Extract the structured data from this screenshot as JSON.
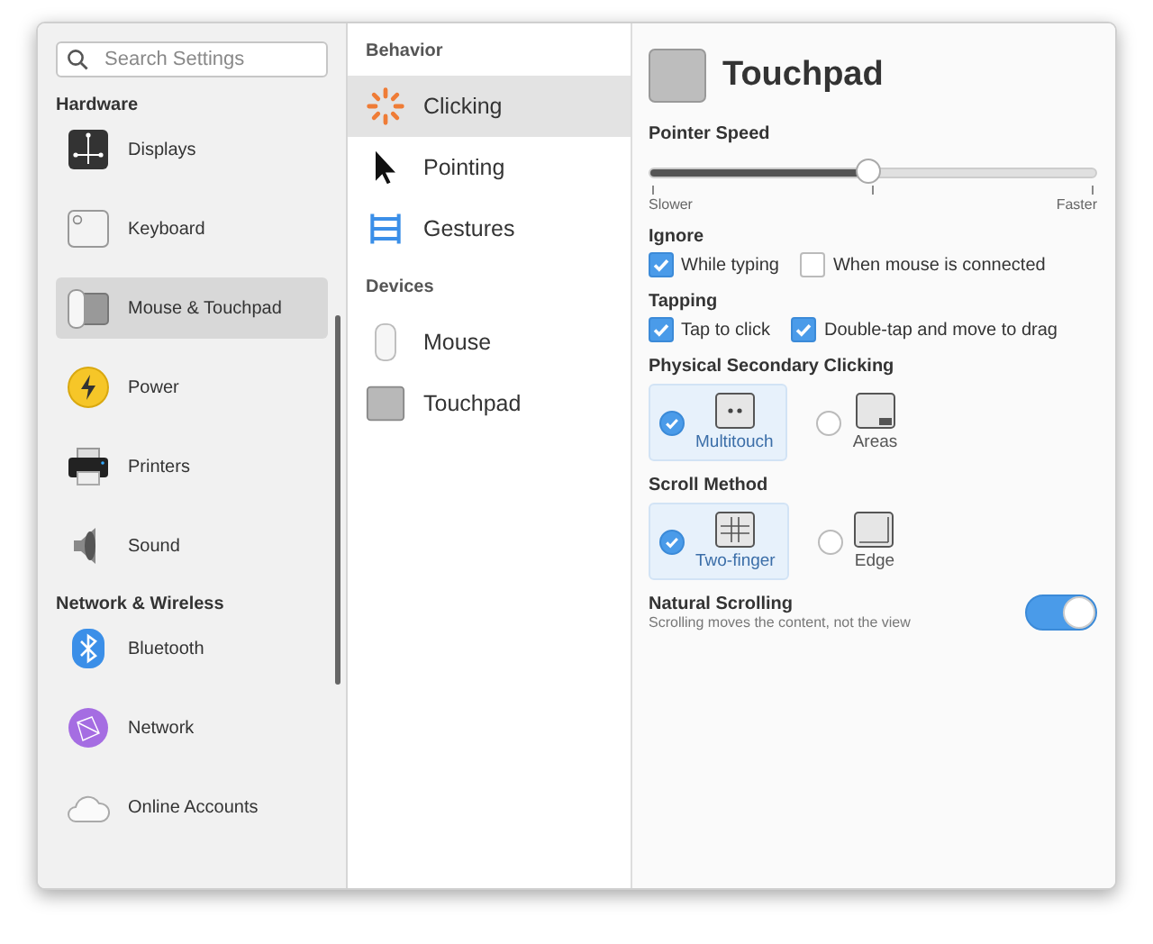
{
  "search": {
    "placeholder": "Search Settings"
  },
  "sidebar": {
    "groups": [
      {
        "title": "Hardware",
        "items": [
          {
            "label": "Displays",
            "selected": false
          },
          {
            "label": "Keyboard",
            "selected": false
          },
          {
            "label": "Mouse & Touchpad",
            "selected": true
          },
          {
            "label": "Power",
            "selected": false
          },
          {
            "label": "Printers",
            "selected": false
          },
          {
            "label": "Sound",
            "selected": false
          }
        ]
      },
      {
        "title": "Network & Wireless",
        "items": [
          {
            "label": "Bluetooth",
            "selected": false
          },
          {
            "label": "Network",
            "selected": false
          },
          {
            "label": "Online Accounts",
            "selected": false
          }
        ]
      }
    ]
  },
  "middle": {
    "groups": [
      {
        "title": "Behavior",
        "items": [
          {
            "label": "Clicking",
            "selected": true
          },
          {
            "label": "Pointing",
            "selected": false
          },
          {
            "label": "Gestures",
            "selected": false
          }
        ]
      },
      {
        "title": "Devices",
        "items": [
          {
            "label": "Mouse",
            "selected": false
          },
          {
            "label": "Touchpad",
            "selected": false
          }
        ]
      }
    ]
  },
  "page": {
    "title": "Touchpad",
    "pointer_speed": {
      "label": "Pointer Speed",
      "level": 0.49,
      "min_label": "Slower",
      "max_label": "Faster"
    },
    "check_groups": [
      {
        "title": "Ignore",
        "options": [
          {
            "label": "While typing",
            "checked": true
          },
          {
            "label": "When mouse is connected",
            "checked": false
          }
        ]
      },
      {
        "title": "Tapping",
        "options": [
          {
            "label": "Tap to click",
            "checked": true
          },
          {
            "label": "Double-tap and move to drag",
            "checked": true
          }
        ]
      }
    ],
    "radio_groups": [
      {
        "title": "Physical Secondary Clicking",
        "options": [
          {
            "label": "Multitouch",
            "selected": true
          },
          {
            "label": "Areas",
            "selected": false
          }
        ]
      },
      {
        "title": "Scroll Method",
        "options": [
          {
            "label": "Two-finger",
            "selected": true
          },
          {
            "label": "Edge",
            "selected": false
          }
        ]
      }
    ],
    "natural_scrolling": {
      "title": "Natural Scrolling",
      "description": "Scrolling moves the content, not the view",
      "on": true
    }
  }
}
